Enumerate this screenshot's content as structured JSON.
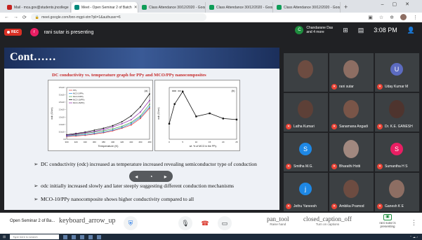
{
  "browser": {
    "tabs": [
      {
        "label": "Mail - mca.gov@students.jncollege",
        "active": false,
        "color": "#c5221f"
      },
      {
        "label": "Meet - Open Seminar 2 of Batch",
        "active": true,
        "color": "#00897b"
      },
      {
        "label": "Class Attendance 30/12/2020 - Google",
        "active": false,
        "color": "#0f9d58"
      },
      {
        "label": "Class Attendance 30/12/2020 - Google",
        "active": false,
        "color": "#0f9d58"
      },
      {
        "label": "Class Attendance 30/12/2020 - Google",
        "active": false,
        "color": "#0f9d58"
      }
    ],
    "new_tab": "+",
    "url": "meet.google.com/bnn-mgpt-xtm?pli=1&authuser=6"
  },
  "meet": {
    "rec_label": "REC",
    "presenter_initial": "r",
    "presenting_text": "rani sutar is presenting",
    "people_initial": "C",
    "people_text_1": "Chandarane Das",
    "people_text_2": "and 4 more",
    "time": "3:08 PM"
  },
  "slide": {
    "title": "Cont……",
    "subtitle": "DC conductivity vs. temperature graph for PPy and MCO/PPy nanocomposites",
    "bullets": [
      "DC conductivity (σdc) increased as temperature increased revealing semiconductor type of conduction",
      "σdc initially increased slowly and later steeply suggesting different conduction mechanisms",
      "MCO-10/PPy nanocomposite shows higher conductivity compared to all"
    ]
  },
  "chart_data": [
    {
      "type": "line",
      "panel": "(a)",
      "xlabel": "Temperature (K)",
      "ylabel": "σdc (S/cm)",
      "x": [
        300,
        320,
        340,
        360,
        380,
        400,
        420,
        440,
        460,
        480
      ],
      "series": [
        {
          "name": "PPy",
          "values": [
            0.2,
            0.25,
            0.3,
            0.4,
            0.5,
            0.65,
            0.85,
            1.1,
            1.6,
            2.4
          ]
        },
        {
          "name": "MCO-2/PPy",
          "values": [
            0.25,
            0.3,
            0.35,
            0.45,
            0.55,
            0.7,
            0.9,
            1.2,
            1.7,
            2.5
          ]
        },
        {
          "name": "MCO-5/PPy",
          "values": [
            0.3,
            0.35,
            0.45,
            0.55,
            0.65,
            0.8,
            1.0,
            1.3,
            1.8,
            2.7
          ]
        },
        {
          "name": "MCO-10/PPy",
          "values": [
            0.35,
            0.45,
            0.55,
            0.7,
            0.85,
            1.05,
            1.35,
            1.8,
            2.5,
            3.5
          ]
        },
        {
          "name": "MCO-15/PPy",
          "values": [
            0.3,
            0.4,
            0.5,
            0.6,
            0.75,
            0.95,
            1.2,
            1.5,
            2.1,
            3.0
          ]
        }
      ],
      "xticks": [
        "300",
        "320",
        "340",
        "360",
        "380",
        "400",
        "420",
        "440",
        "460",
        "480"
      ],
      "yticks": [
        "0.0",
        "5.0x10⁻⁵",
        "1.0x10⁻⁴",
        "1.5x10⁻⁴",
        "2.0x10⁻⁴",
        "2.5x10⁻⁴",
        "3.0x10⁻⁴",
        "3.5x10⁻⁴"
      ]
    },
    {
      "type": "line",
      "panel": "(b)",
      "xlabel": "wt. % of MCO in the PPy",
      "ylabel": "σdc (S/cm)",
      "x": [
        0,
        2,
        5,
        10,
        15,
        20,
        25
      ],
      "series": [
        {
          "name": "300 K",
          "values": [
            1.5,
            3.4,
            4.6,
            2.2,
            2.5,
            2.0,
            1.9
          ]
        }
      ],
      "xticks": [
        "0",
        "5",
        "10",
        "15",
        "20",
        "25"
      ]
    }
  ],
  "participants": [
    {
      "name": "",
      "initial": "",
      "color": "#6d4c41",
      "has_photo": true
    },
    {
      "name": "rani sutar",
      "initial": "",
      "color": "#8d6e63",
      "has_photo": true
    },
    {
      "name": "Uday Kumar M",
      "initial": "U",
      "color": "#5c6bc0",
      "has_photo": false
    },
    {
      "name": "Latha Kumari",
      "initial": "",
      "color": "#5d4037",
      "has_photo": true
    },
    {
      "name": "Sanamana Angadi",
      "initial": "",
      "color": "#795548",
      "has_photo": true
    },
    {
      "name": "Dr. K.E. GANESH",
      "initial": "",
      "color": "#4e342e",
      "has_photo": true
    },
    {
      "name": "Smitha M.G.",
      "initial": "S",
      "color": "#1e88e5",
      "has_photo": false
    },
    {
      "name": "Bharathi Hotti",
      "initial": "",
      "color": "#a1887f",
      "has_photo": true
    },
    {
      "name": "Sumantha H S",
      "initial": "S",
      "color": "#e91e63",
      "has_photo": false
    },
    {
      "name": "Jethu Yaneesh",
      "initial": "j",
      "color": "#1e88e5",
      "has_photo": false
    },
    {
      "name": "Ambika Pramod",
      "initial": "",
      "color": "#6d4c41",
      "has_photo": true
    },
    {
      "name": "Ganesh K E",
      "initial": "",
      "color": "#8d6e63",
      "has_photo": true
    }
  ],
  "bottom": {
    "meeting_title": "Open Seminar 2 of Ba...",
    "keyboard_label": "keyboard_arrow_up",
    "pan_tool": "pan_tool",
    "raise_hand": "Raise hand",
    "cc_label": "closed_caption_off",
    "cc_sub": "Turn on captions",
    "present_label": "rani sutar is presenting",
    "more": "⋮"
  },
  "taskbar": {
    "search": "Type here to search"
  }
}
